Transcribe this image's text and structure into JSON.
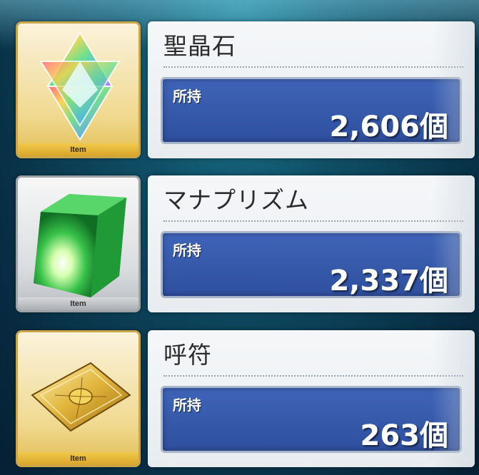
{
  "items": [
    {
      "name": "聖晶石",
      "held_label": "所持",
      "count": "2,606個",
      "thumb_label": "Item",
      "icon": "saint-quartz-icon",
      "frame": "gold"
    },
    {
      "name": "マナプリズム",
      "held_label": "所持",
      "count": "2,337個",
      "thumb_label": "Item",
      "icon": "mana-prism-icon",
      "frame": "silver"
    },
    {
      "name": "呼符",
      "held_label": "所持",
      "count": "263個",
      "thumb_label": "Item",
      "icon": "summon-ticket-icon",
      "frame": "gold"
    }
  ],
  "colors": {
    "count_box": "#3656a8",
    "gold_frame": "#c9a64a",
    "silver_frame": "#9ea3a8"
  }
}
